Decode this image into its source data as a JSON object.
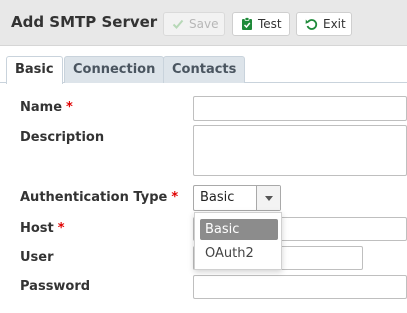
{
  "window": {
    "title": "Add SMTP Server"
  },
  "toolbar": {
    "save_label": "Save",
    "test_label": "Test",
    "exit_label": "Exit"
  },
  "tabs": [
    {
      "label": "Basic",
      "active": true
    },
    {
      "label": "Connection",
      "active": false
    },
    {
      "label": "Contacts",
      "active": false
    }
  ],
  "form": {
    "required_marker": "*",
    "name": {
      "label": "Name",
      "value": ""
    },
    "description": {
      "label": "Description",
      "value": ""
    },
    "auth_type": {
      "label": "Authentication Type",
      "value": "Basic",
      "options": [
        "Basic",
        "OAuth2"
      ]
    },
    "host": {
      "label": "Host",
      "value": ""
    },
    "user": {
      "label": "User",
      "value": ""
    },
    "password": {
      "label": "Password",
      "value": ""
    }
  },
  "colors": {
    "required": "#e00000",
    "titlebar": "#e8e8e8",
    "tab_inactive": "#dde4ea",
    "selected_option": "#8c8c8c"
  }
}
